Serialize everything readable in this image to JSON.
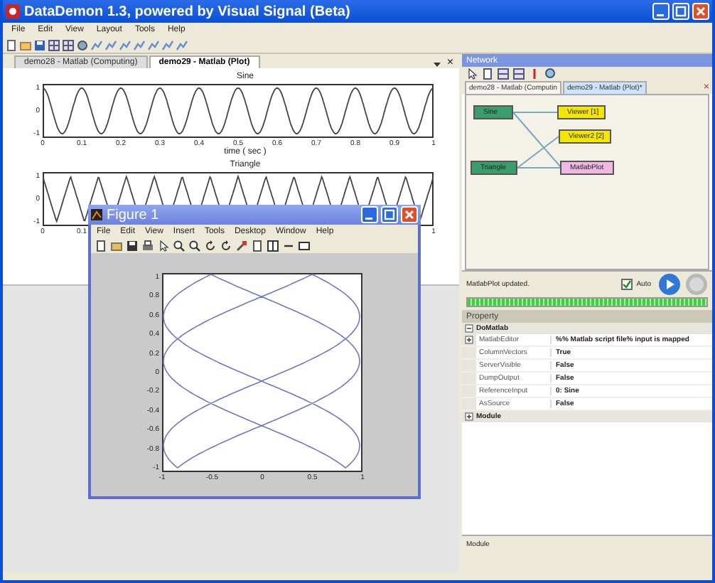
{
  "window": {
    "title": "DataDemon 1.3, powered by Visual Signal (Beta)"
  },
  "menu": [
    "File",
    "Edit",
    "View",
    "Layout",
    "Tools",
    "Help"
  ],
  "doc_tabs": [
    {
      "label": "demo28 - Matlab (Computing)",
      "selected": false
    },
    {
      "label": "demo29 - Matlab (Plot)",
      "selected": true
    }
  ],
  "doc_close": "×",
  "plots": [
    {
      "title": "Sine",
      "kind": "sine",
      "yticks": [
        "1",
        "0",
        "-1"
      ],
      "xticks": [
        "0",
        "0.1",
        "0.2",
        "0.3",
        "0.4",
        "0.5",
        "0.6",
        "0.7",
        "0.8",
        "0.9",
        "1"
      ],
      "xlabel": "time ( sec )"
    },
    {
      "title": "Triangle",
      "kind": "triangle",
      "yticks": [
        "1",
        "0",
        "-1"
      ],
      "xticks": [
        "0",
        "0.1",
        "1"
      ]
    }
  ],
  "figure": {
    "title": "Figure 1",
    "menu": [
      "File",
      "Edit",
      "View",
      "Insert",
      "Tools",
      "Desktop",
      "Window",
      "Help"
    ],
    "yticks": [
      "1",
      "0.8",
      "0.6",
      "0.4",
      "0.2",
      "0",
      "-0.2",
      "-0.4",
      "-0.6",
      "-0.8",
      "-1"
    ],
    "xticks": [
      "-1",
      "-0.5",
      "0",
      "0.5",
      "1"
    ]
  },
  "network": {
    "title": "Network",
    "tabs": [
      {
        "label": "demo28 - Matlab (Computin",
        "selected": false
      },
      {
        "label": "demo29 - Matlab (Plot)*",
        "selected": true
      }
    ],
    "close": "×",
    "nodes": [
      {
        "label": "Sine",
        "kind": "source"
      },
      {
        "label": "Viewer [1]",
        "kind": "viewer"
      },
      {
        "label": "Viewer2 [2]",
        "kind": "viewer"
      },
      {
        "label": "Triangle",
        "kind": "source"
      },
      {
        "label": "MatlabPlot",
        "kind": "plot"
      }
    ]
  },
  "status": {
    "message": "MatlabPlot updated.",
    "auto_label": "Auto",
    "auto_checked": true,
    "level": 1
  },
  "property": {
    "title": "Property",
    "groups": [
      {
        "name": "DoMatlab",
        "expanded": true,
        "rows": [
          {
            "name": "MatlabEditor",
            "value": "%% Matlab script file% input is mapped",
            "expandable": true
          },
          {
            "name": "ColumnVectors",
            "value": "True",
            "expandable": false
          },
          {
            "name": "ServerVisible",
            "value": "False",
            "expandable": false
          },
          {
            "name": "DumpOutput",
            "value": "False",
            "expandable": false
          },
          {
            "name": "ReferenceInput",
            "value": "0: Sine",
            "expandable": false
          },
          {
            "name": "AsSource",
            "value": "False",
            "expandable": false
          }
        ]
      },
      {
        "name": "Module",
        "expanded": false
      }
    ]
  },
  "description": "Module"
}
